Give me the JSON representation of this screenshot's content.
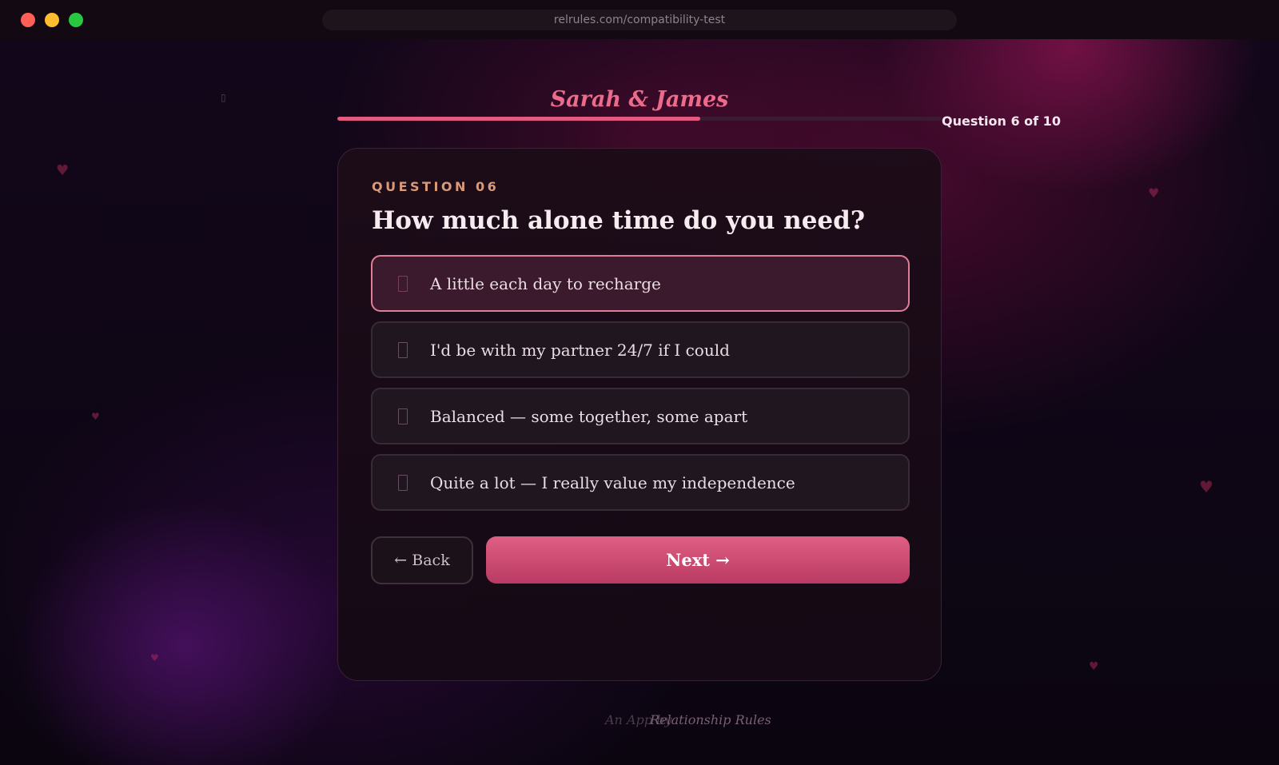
{
  "window": {
    "url": "relrules.com/compatibility-test",
    "colors": {
      "close": "#fe5f57",
      "minimize": "#febc2e",
      "maximize": "#28c840"
    }
  },
  "quiz": {
    "couple": "Sarah & James",
    "progress_label": "Question 6 of 10",
    "progress_fraction": 0.6,
    "question_label": "QUESTION 06",
    "question_title": "How much alone time do you need?",
    "options": [
      {
        "label": "A little each day to recharge",
        "selected": true
      },
      {
        "label": "I'd be with my partner 24/7 if I could",
        "selected": false
      },
      {
        "label": "Balanced — some together, some apart",
        "selected": false
      },
      {
        "label": "Quite a lot — I really value my independence",
        "selected": false
      }
    ],
    "back_label": "← Back",
    "next_label": "Next →"
  },
  "footer": {
    "text_a": "An App by",
    "text_b": "Relationship Rules"
  },
  "colors": {
    "accent": "#e25a7f",
    "question_label": "#d89a7b",
    "selected_border": "#e07d98"
  }
}
